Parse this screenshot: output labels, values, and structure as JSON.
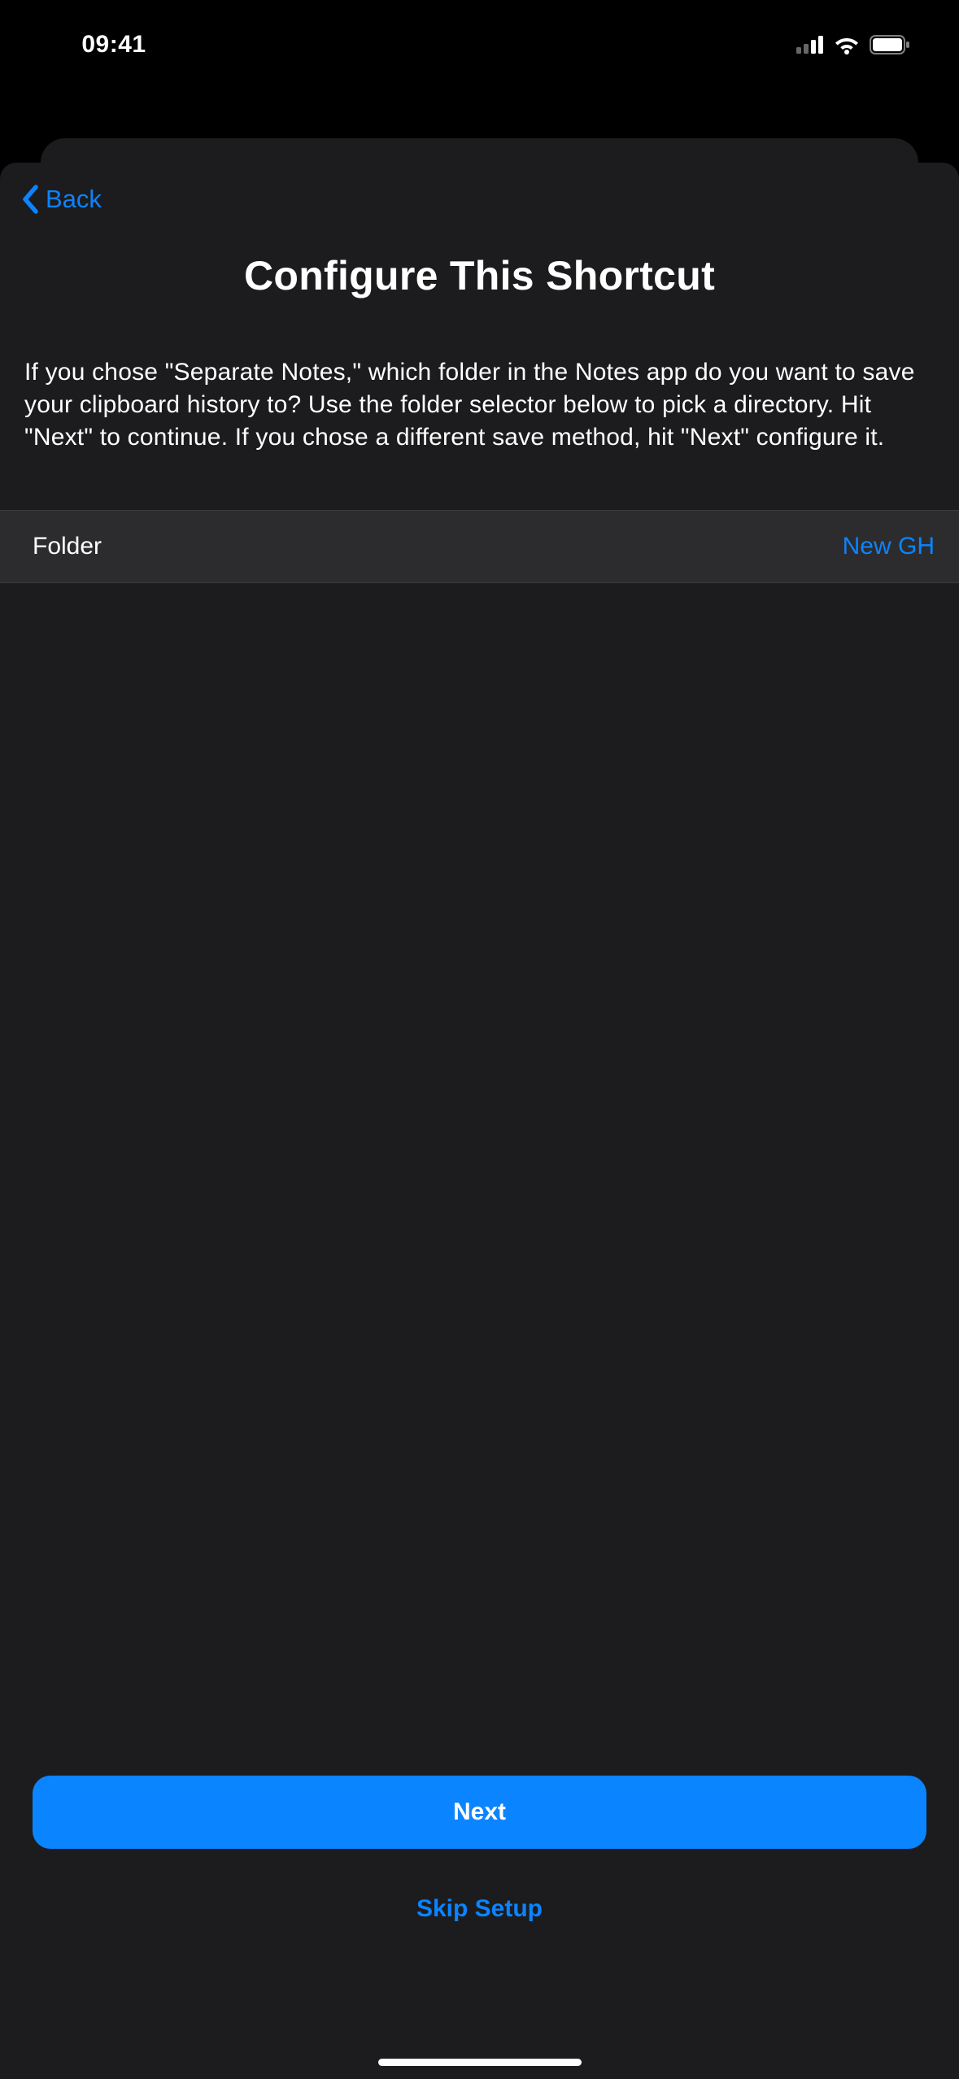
{
  "statusBar": {
    "time": "09:41"
  },
  "nav": {
    "backLabel": "Back"
  },
  "page": {
    "title": "Configure This Shortcut",
    "description": "If you chose \"Separate Notes,\" which folder in the Notes app do you want to save your clipboard history to? Use the folder selector below to pick a directory. Hit \"Next\" to continue. If you chose a different save method, hit \"Next\" configure it."
  },
  "folderRow": {
    "label": "Folder",
    "value": "New GH"
  },
  "actions": {
    "nextLabel": "Next",
    "skipLabel": "Skip Setup"
  }
}
